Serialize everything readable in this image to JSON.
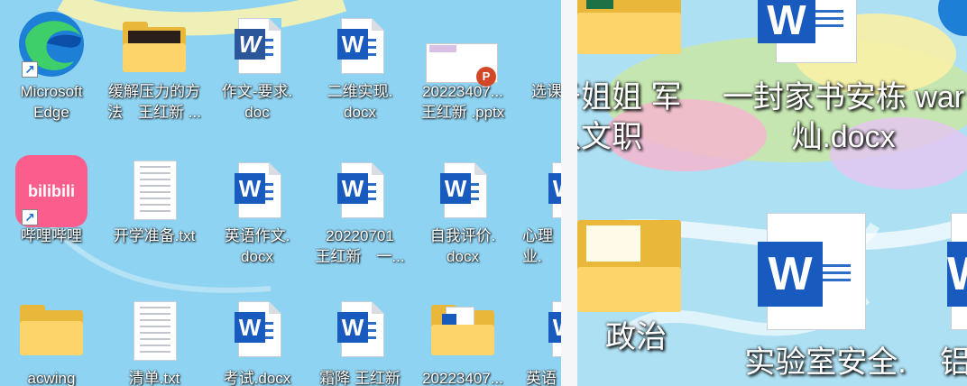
{
  "left_icons": [
    {
      "label": "Microsoft\nEdge",
      "type": "edge"
    },
    {
      "label": "缓解压力的方\n法　王红新 ...",
      "type": "folder-photo"
    },
    {
      "label": "作文-要求.\ndoc",
      "type": "word-old"
    },
    {
      "label": "二维实现.\ndocx",
      "type": "word"
    },
    {
      "label": "20223407...\n王红新 .pptx",
      "type": "pptx"
    },
    {
      "label": "选课",
      "type": "partial"
    },
    {
      "label": "哔哩哔哩",
      "type": "bilibili"
    },
    {
      "label": "开学准备.txt",
      "type": "txt"
    },
    {
      "label": "英语作文.\ndocx",
      "type": "word"
    },
    {
      "label": "20220701\n王红新　一...",
      "type": "word"
    },
    {
      "label": "自我评价.\ndocx",
      "type": "word"
    },
    {
      "label": "心理\n业.",
      "type": "word-partial"
    },
    {
      "label": "acwing",
      "type": "folder"
    },
    {
      "label": "清单.txt",
      "type": "txt"
    },
    {
      "label": "考试.docx",
      "type": "word"
    },
    {
      "label": "霜降 王红新",
      "type": "word"
    },
    {
      "label": "20223407...",
      "type": "folder-doc"
    },
    {
      "label": "英语",
      "type": "word-partial"
    }
  ],
  "right_icons": [
    {
      "label": "于姐姐 军\n队文职",
      "type": "folder"
    },
    {
      "label": "一封家书安栋 war\n灿.docx",
      "type": "word"
    },
    {
      "label": "政治",
      "type": "folder"
    },
    {
      "label": "实验室安全.",
      "type": "word"
    },
    {
      "label": "铝",
      "type": "partial"
    }
  ],
  "word_badge": "W",
  "bilibili_text": "bilibili",
  "colors": {
    "wallpaper": "#8fd3f2",
    "word_blue": "#185abd",
    "folder": "#fcd46a"
  }
}
